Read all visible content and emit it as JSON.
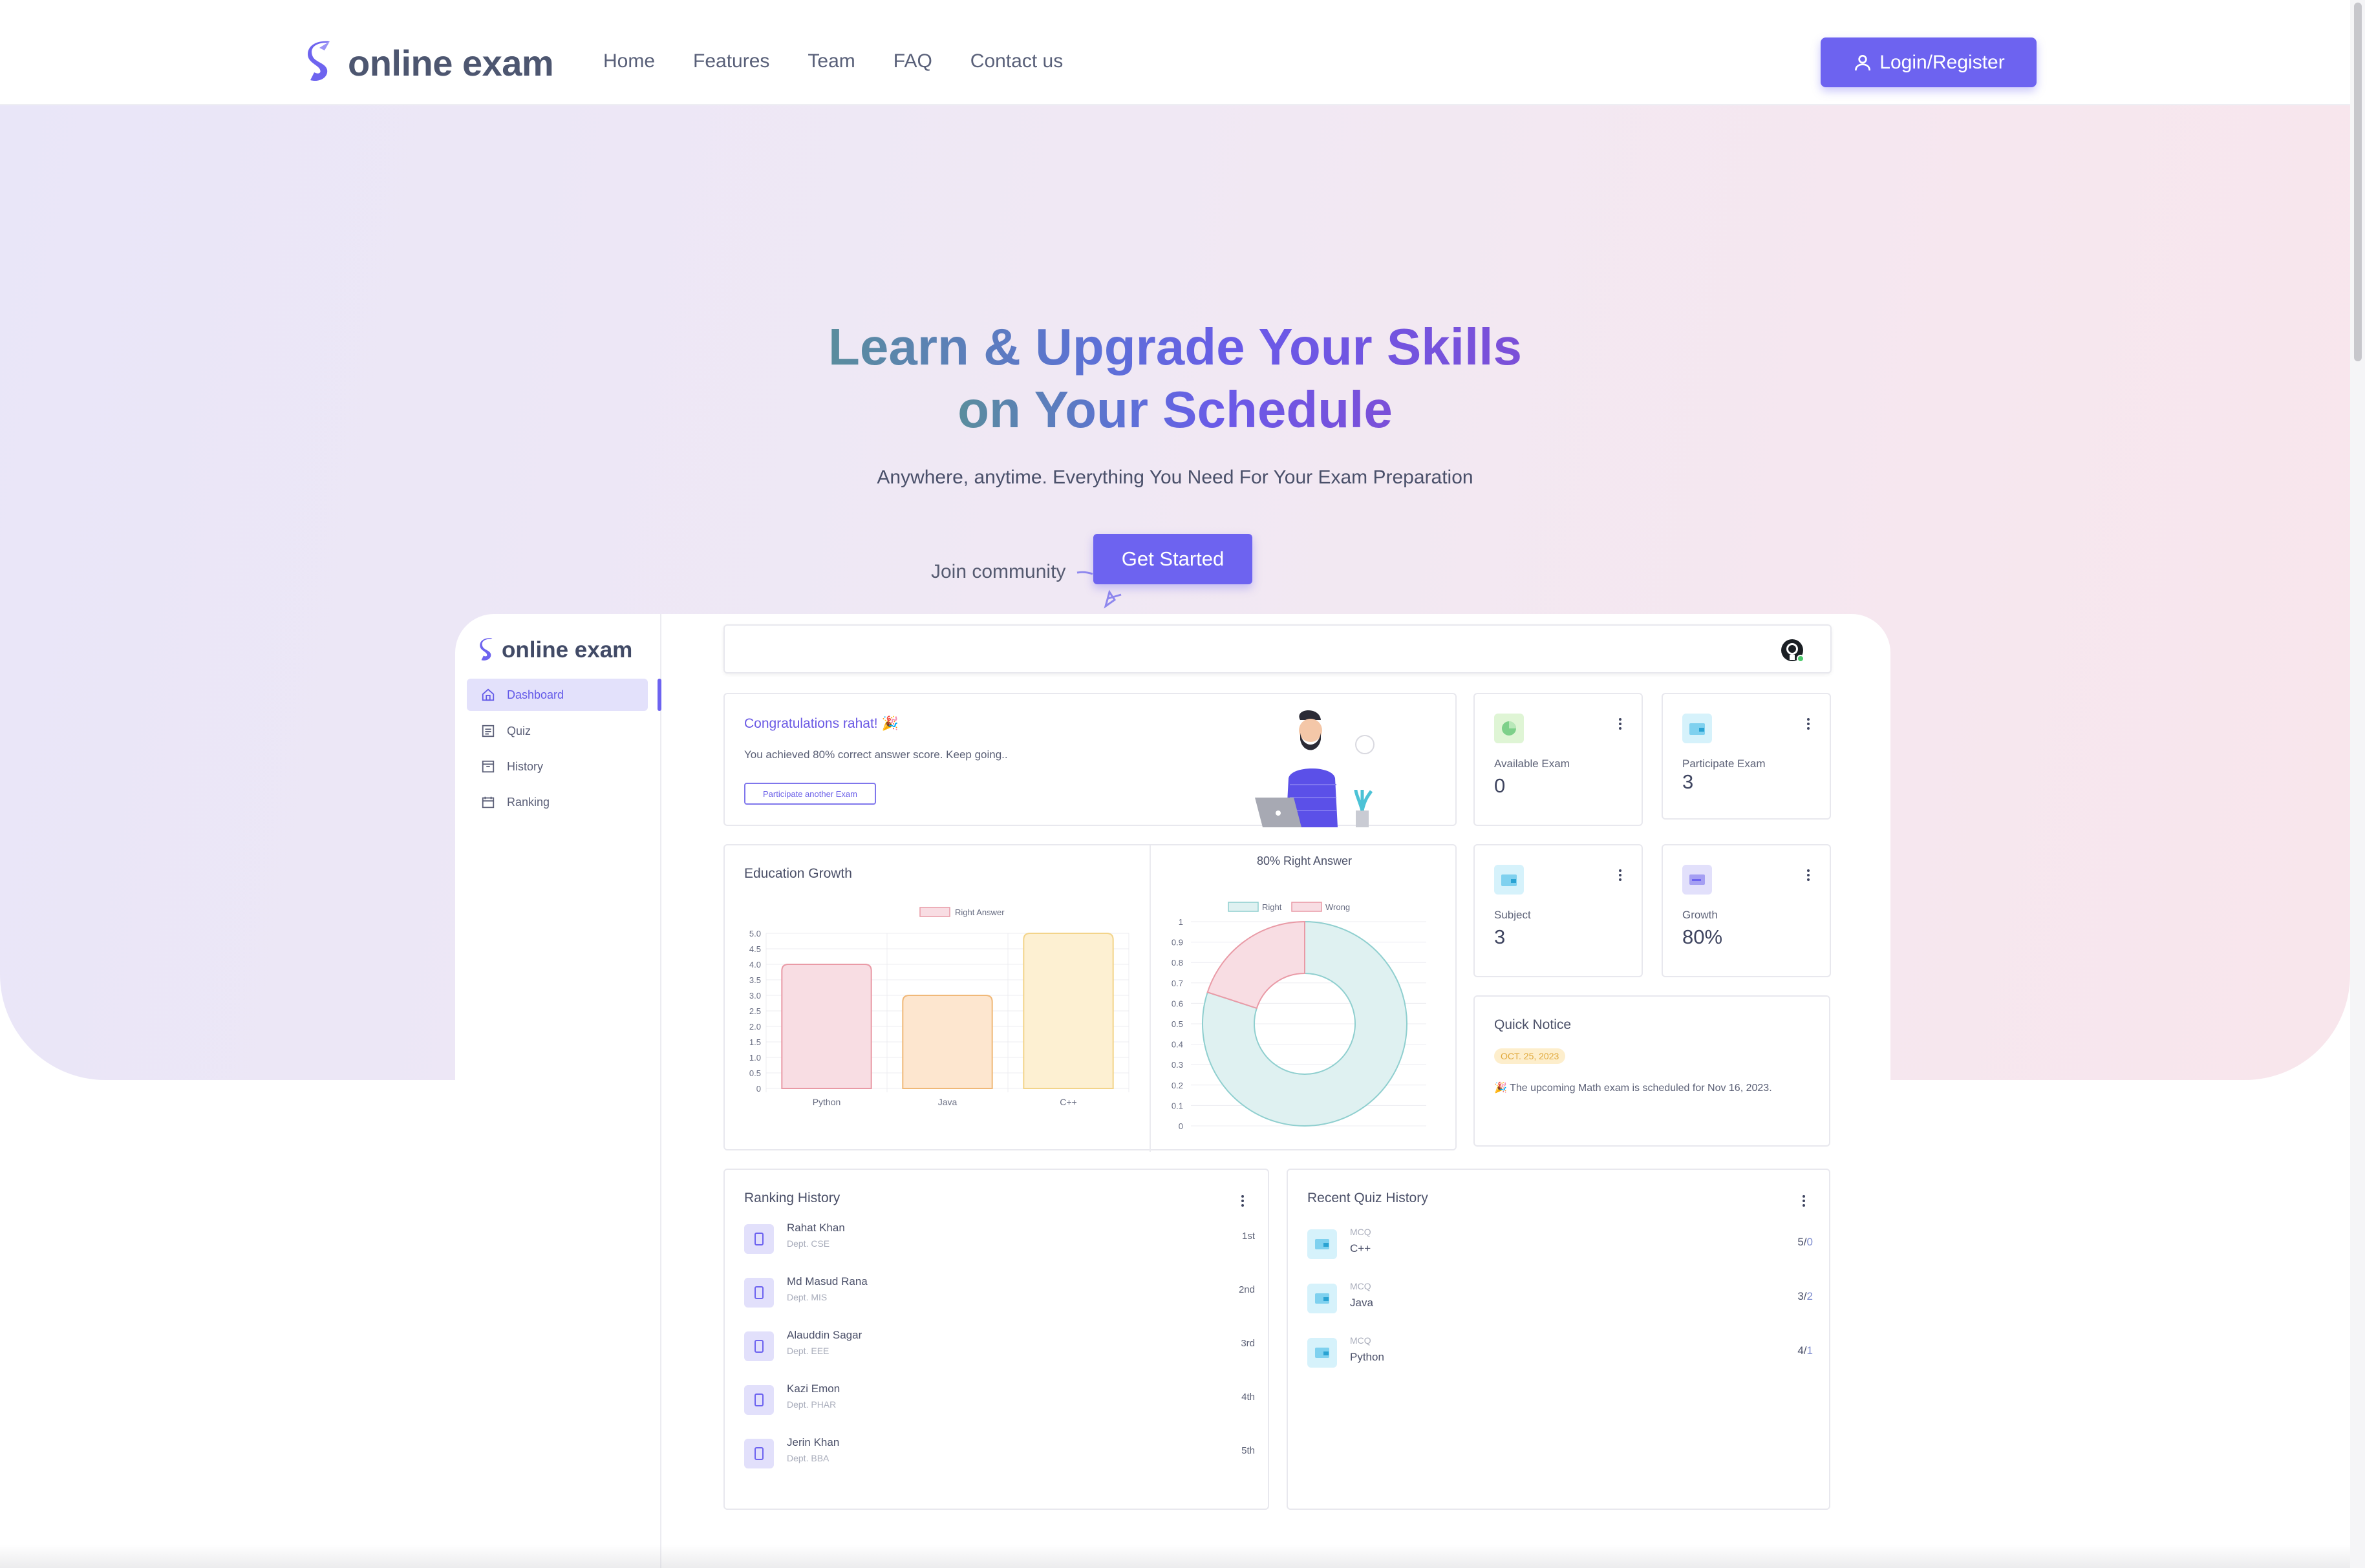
{
  "navbar": {
    "brand": "online exam",
    "links": [
      "Home",
      "Features",
      "Team",
      "FAQ",
      "Contact us"
    ],
    "login_label": "Login/Register"
  },
  "hero": {
    "title_line1": "Learn & Upgrade Your Skills",
    "title_line2": "on Your Schedule",
    "subtitle": "Anywhere, anytime. Everything You Need For Your Exam Preparation",
    "join_text": "Join community",
    "cta_label": "Get Started"
  },
  "dashboard": {
    "brand": "online exam",
    "sidebar": [
      {
        "label": "Dashboard",
        "icon": "home-icon",
        "active": true
      },
      {
        "label": "Quiz",
        "icon": "list-icon",
        "active": false
      },
      {
        "label": "History",
        "icon": "archive-icon",
        "active": false
      },
      {
        "label": "Ranking",
        "icon": "trophy-icon",
        "active": false
      }
    ],
    "congrats": {
      "title": "Congratulations rahat! 🎉",
      "text": "You achieved 80% correct answer score. Keep going..",
      "button": "Participate another Exam"
    },
    "stats": [
      {
        "label": "Available Exam",
        "value": "0",
        "icon": "pie-icon",
        "color": "#dff5d5"
      },
      {
        "label": "Participate Exam",
        "value": "3",
        "icon": "folder-icon",
        "color": "#d6f2fb"
      },
      {
        "label": "Subject",
        "value": "3",
        "icon": "folder-icon",
        "color": "#d6f2fb"
      },
      {
        "label": "Growth",
        "value": "80%",
        "icon": "card-icon",
        "color": "#e2e0fb"
      }
    ],
    "growth_title": "Education Growth",
    "notice": {
      "title": "Quick Notice",
      "date": "OCT. 25, 2023",
      "text": "🎉 The upcoming Math exam is scheduled for Nov 16, 2023."
    },
    "ranking": {
      "title": "Ranking History",
      "rows": [
        {
          "name": "Rahat Khan",
          "dept": "Dept. CSE",
          "pos": "1st"
        },
        {
          "name": "Md Masud Rana",
          "dept": "Dept. MIS",
          "pos": "2nd"
        },
        {
          "name": "Alauddin Sagar",
          "dept": "Dept. EEE",
          "pos": "3rd"
        },
        {
          "name": "Kazi Emon",
          "dept": "Dept. PHAR",
          "pos": "4th"
        },
        {
          "name": "Jerin Khan",
          "dept": "Dept. BBA",
          "pos": "5th"
        }
      ]
    },
    "quiz_history": {
      "title": "Recent Quiz History",
      "rows": [
        {
          "type": "MCQ",
          "name": "C++",
          "score": "5/",
          "total": "0"
        },
        {
          "type": "MCQ",
          "name": "Java",
          "score": "3/",
          "total": "2"
        },
        {
          "type": "MCQ",
          "name": "Python",
          "score": "4/",
          "total": "1"
        }
      ]
    }
  },
  "colors": {
    "accent": "#6d63f0",
    "hero_bg_start": "#e9e6f8",
    "hero_bg_end": "#f8e6ec"
  },
  "chart_data": [
    {
      "type": "bar",
      "categories": [
        "Python",
        "Java",
        "C++"
      ],
      "series": [
        {
          "name": "Right Answer",
          "values": [
            4.0,
            3.0,
            5.0
          ]
        }
      ],
      "bar_colors": [
        "#f8dde3",
        "#fde6cf",
        "#fdf0d2"
      ],
      "bar_borders": [
        "#e99aa6",
        "#f0b878",
        "#f3d48a"
      ],
      "ylim": [
        0,
        5
      ],
      "yticks": [
        "5.0",
        "4.5",
        "4.0",
        "3.5",
        "3.0",
        "2.5",
        "2.0",
        "1.5",
        "1.0",
        "0.5",
        "0"
      ],
      "grid": true,
      "legend": "top"
    },
    {
      "type": "pie",
      "title": "80% Right Answer",
      "labels": [
        "Right",
        "Wrong"
      ],
      "values": [
        80,
        20
      ],
      "colors": [
        "#dff1f1",
        "#f8dde3"
      ],
      "border_colors": [
        "#8fcfcf",
        "#e99aa6"
      ],
      "yticks": [
        "1",
        "0.9",
        "0.8",
        "0.7",
        "0.6",
        "0.5",
        "0.4",
        "0.3",
        "0.2",
        "0.1",
        "0"
      ],
      "legend": "top"
    }
  ]
}
